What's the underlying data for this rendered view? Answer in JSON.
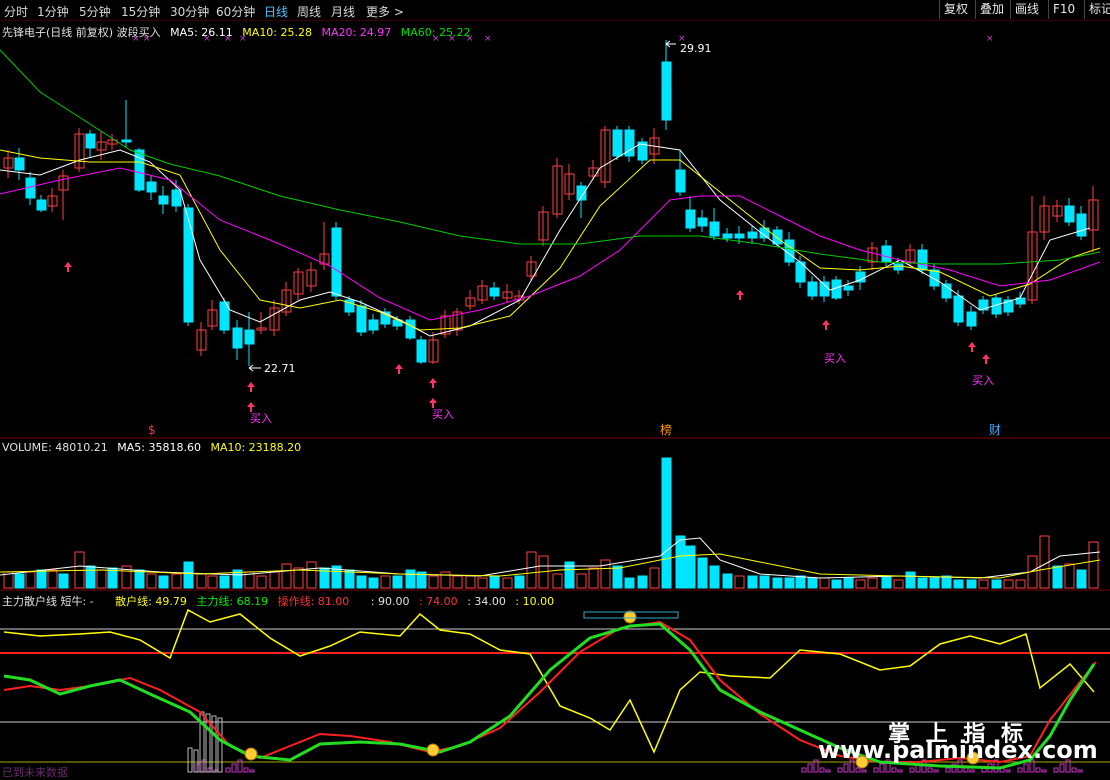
{
  "toolbar": {
    "periods": [
      "分时",
      "1分钟",
      "5分钟",
      "15分钟",
      "30分钟",
      "60分钟",
      "日线",
      "周线",
      "月线",
      "更多 >"
    ],
    "active_period": "日线",
    "right_buttons": [
      "复权",
      "叠加",
      "画线",
      "F10",
      "标记"
    ]
  },
  "price_panel": {
    "title": "先锋电子(日线 前复权) 波段买入",
    "ma5": "MA5: 26.11",
    "ma10": "MA10: 25.28",
    "ma20": "MA20: 24.97",
    "ma60": "MA60: 25.22",
    "high_label": "29.91",
    "low_label": "22.71",
    "buy_label": "买入",
    "markers": [
      "$",
      "榜",
      "财"
    ]
  },
  "volume_panel": {
    "volume": "VOLUME: 48010.21",
    "ma5": "MA5: 35818.60",
    "ma10": "MA10: 23188.20"
  },
  "indicator_panel": {
    "name": "主力散户线 短牛: -",
    "retail": "散户线: 49.79",
    "main": "主力线: 68.19",
    "operate": "操作线: 81.00",
    "level1": ": 90.00",
    "level2": ": 74.00",
    "level3": ": 34.00",
    "level4": ": 10.00",
    "bottom_text": "已到未来数据"
  },
  "watermark": {
    "cn": "掌 上 指 标",
    "url": "www.palmindex.com"
  },
  "colors": {
    "up": "#ff4040",
    "down": "#00e5ff",
    "ma5": "#ffffff",
    "ma10": "#ffff00",
    "ma20": "#ff00ff",
    "ma60": "#00cc00",
    "buy": "#ff3366"
  }
}
